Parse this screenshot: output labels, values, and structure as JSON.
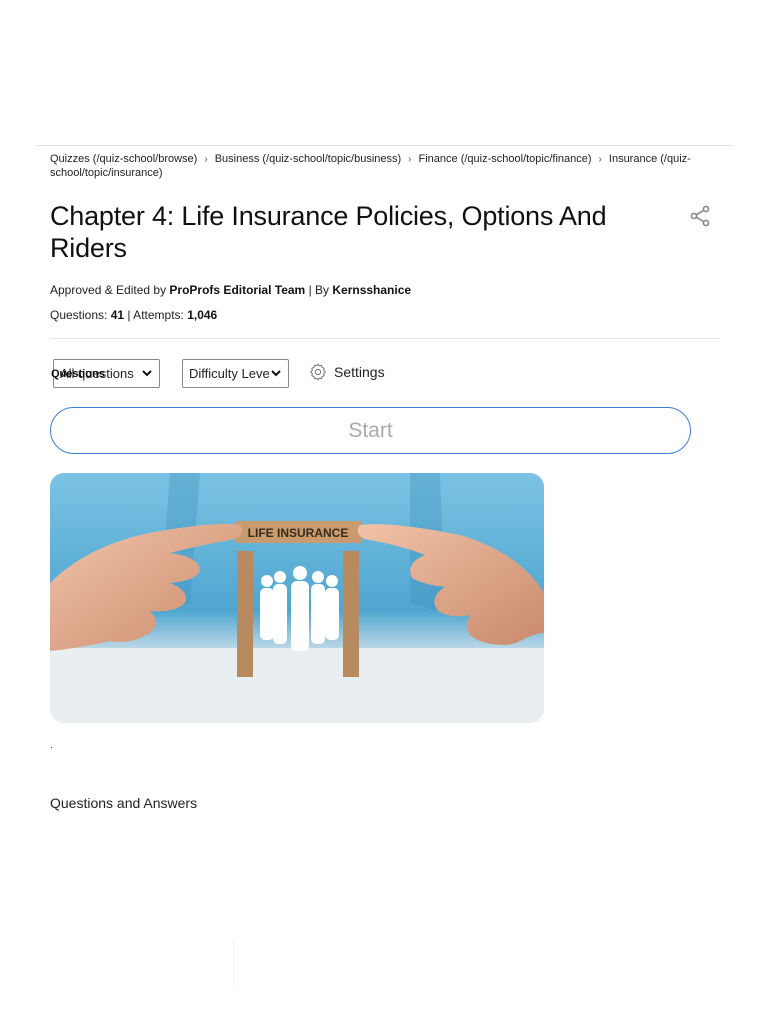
{
  "breadcrumb": {
    "items": [
      {
        "label": "Quizzes (/quiz-school/browse)"
      },
      {
        "label": "Business (/quiz-school/topic/business)"
      },
      {
        "label": "Finance (/quiz-school/topic/finance)"
      },
      {
        "label": "Insurance (/quiz-school/topic/insurance)"
      }
    ],
    "separator": "›"
  },
  "quiz": {
    "title": "Chapter 4: Life Insurance Policies, Options And Riders",
    "approved_prefix": "Approved & Edited by ",
    "editor": "ProProfs Editorial Team",
    "by_prefix": " | By ",
    "author": "Kernsshanice",
    "questions_label": "Questions: ",
    "questions_count": "41",
    "attempts_label": " | Attempts: ",
    "attempts_count": "1,046"
  },
  "controls": {
    "questions_select": "All questions",
    "questions_overlay": "Questions",
    "difficulty_select": "Difficulty Leve",
    "settings_label": "Settings",
    "start_label": "Start"
  },
  "hero": {
    "sign_text": "LIFE INSURANCE"
  },
  "dot_text": ".",
  "section": {
    "qa_title": "Questions and Answers"
  },
  "colors": {
    "accent": "#3b7dd8",
    "start_text": "#a9a9a9",
    "shirt": "#5fb0d6"
  },
  "icons": {
    "share": "share-icon",
    "settings": "gear-icon",
    "chevron": "chevron-down-icon"
  }
}
